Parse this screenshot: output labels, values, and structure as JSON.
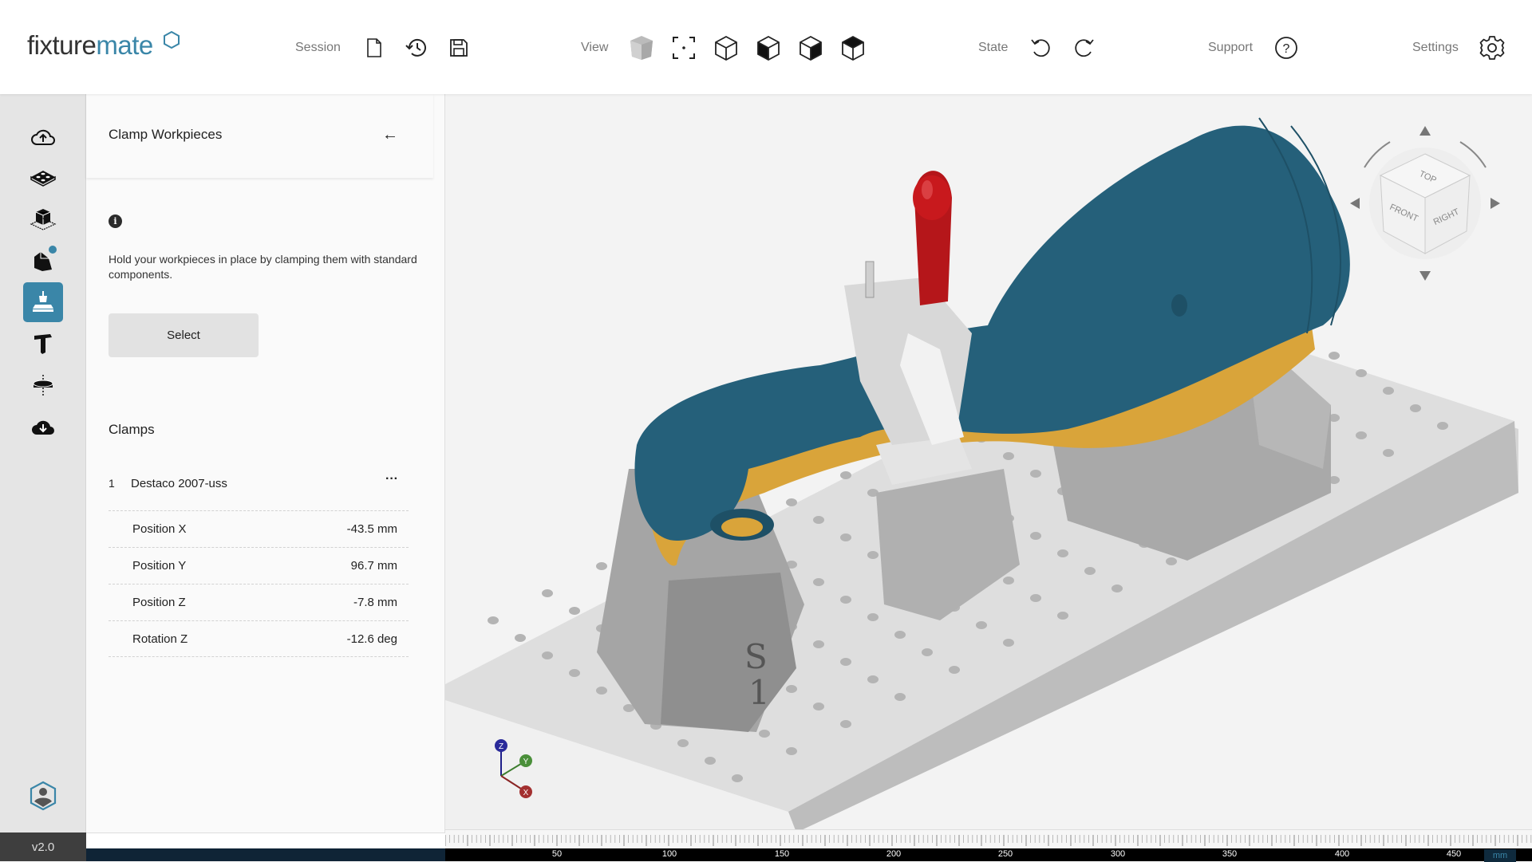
{
  "app": {
    "logo_part1": "fixture",
    "logo_part2": "mate",
    "version": "v2.0",
    "accent_color": "#3a86a8"
  },
  "toolbar": {
    "groups": [
      {
        "label": "Session",
        "buttons": [
          "new-file",
          "history",
          "save"
        ]
      },
      {
        "label": "View",
        "buttons": [
          "shaded-view",
          "fit-view",
          "iso-wireframe",
          "front-view",
          "right-view",
          "top-view"
        ]
      },
      {
        "label": "State",
        "buttons": [
          "undo",
          "redo"
        ]
      },
      {
        "label": "Support",
        "buttons": [
          "help"
        ]
      },
      {
        "label": "Settings",
        "buttons": [
          "settings"
        ]
      }
    ]
  },
  "rail": {
    "items": [
      {
        "name": "upload",
        "active": false
      },
      {
        "name": "baseplate",
        "active": false
      },
      {
        "name": "workpiece",
        "active": false
      },
      {
        "name": "supports",
        "active": false,
        "badge": true
      },
      {
        "name": "clamps",
        "active": true
      },
      {
        "name": "t-slot",
        "active": false
      },
      {
        "name": "rotation",
        "active": false
      },
      {
        "name": "download",
        "active": false
      }
    ]
  },
  "panel": {
    "title": "Clamp Workpieces",
    "back": "←",
    "description": "Hold your workpieces in place by clamping them with standard components.",
    "select_label": "Select",
    "clamps_title": "Clamps",
    "clamps": [
      {
        "index": "1",
        "name": "Destaco 2007-uss",
        "more": "···",
        "properties": [
          {
            "label": "Position X",
            "value": "-43.5 mm"
          },
          {
            "label": "Position Y",
            "value": "96.7 mm"
          },
          {
            "label": "Position Z",
            "value": "-7.8 mm"
          },
          {
            "label": "Rotation Z",
            "value": "-12.6 deg"
          }
        ]
      }
    ]
  },
  "viewcube": {
    "top": "TOP",
    "front": "FRONT",
    "right": "RIGHT"
  },
  "axes": {
    "x": "X",
    "y": "Y",
    "z": "Z"
  },
  "ruler": {
    "unit": "mm",
    "labels": [
      "50",
      "100",
      "150",
      "200",
      "250",
      "300",
      "350",
      "400",
      "450"
    ]
  }
}
